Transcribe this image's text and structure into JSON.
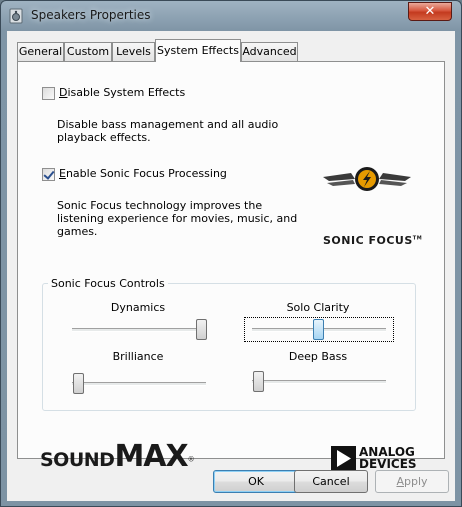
{
  "window": {
    "title": "Speakers Properties",
    "close_glyph": "✕"
  },
  "tabs": [
    {
      "label": "General"
    },
    {
      "label": "Custom"
    },
    {
      "label": "Levels"
    },
    {
      "label": "System Effects",
      "active": true
    },
    {
      "label": "Advanced"
    }
  ],
  "effects": {
    "disable": {
      "label_first": "D",
      "label_rest": "isable System Effects",
      "checked": false,
      "description": "Disable bass management and all audio playback effects."
    },
    "sonic_focus": {
      "label_first": "E",
      "label_rest": "nable Sonic Focus Processing",
      "checked": true,
      "description": "Sonic Focus technology improves the listening experience for movies, music, and games."
    }
  },
  "sonic_focus_logo": {
    "text": "SONIC FOCUS",
    "tm": "TM"
  },
  "controls": {
    "group_title": "Sonic Focus Controls",
    "sliders": [
      {
        "label": "Dynamics",
        "value_fraction": 1.0
      },
      {
        "label": "Solo Clarity",
        "value_fraction": 0.5,
        "focused": true
      },
      {
        "label": "Brilliance",
        "value_fraction": 0.0
      },
      {
        "label": "Deep Bass",
        "value_fraction": 0.0
      }
    ]
  },
  "branding": {
    "soundmax_light": "SOUND",
    "soundmax_bold": "MAX",
    "soundmax_reg": "®",
    "analog_line1": "ANALOG",
    "analog_line2": "DEVICES"
  },
  "buttons": {
    "ok": "OK",
    "cancel": "Cancel",
    "apply_first": "A",
    "apply_rest": "pply",
    "apply_enabled": false
  },
  "colors": {
    "accent": "#3c7fb1",
    "close": "#c33a1f",
    "checkmark": "#2a4f8e"
  }
}
